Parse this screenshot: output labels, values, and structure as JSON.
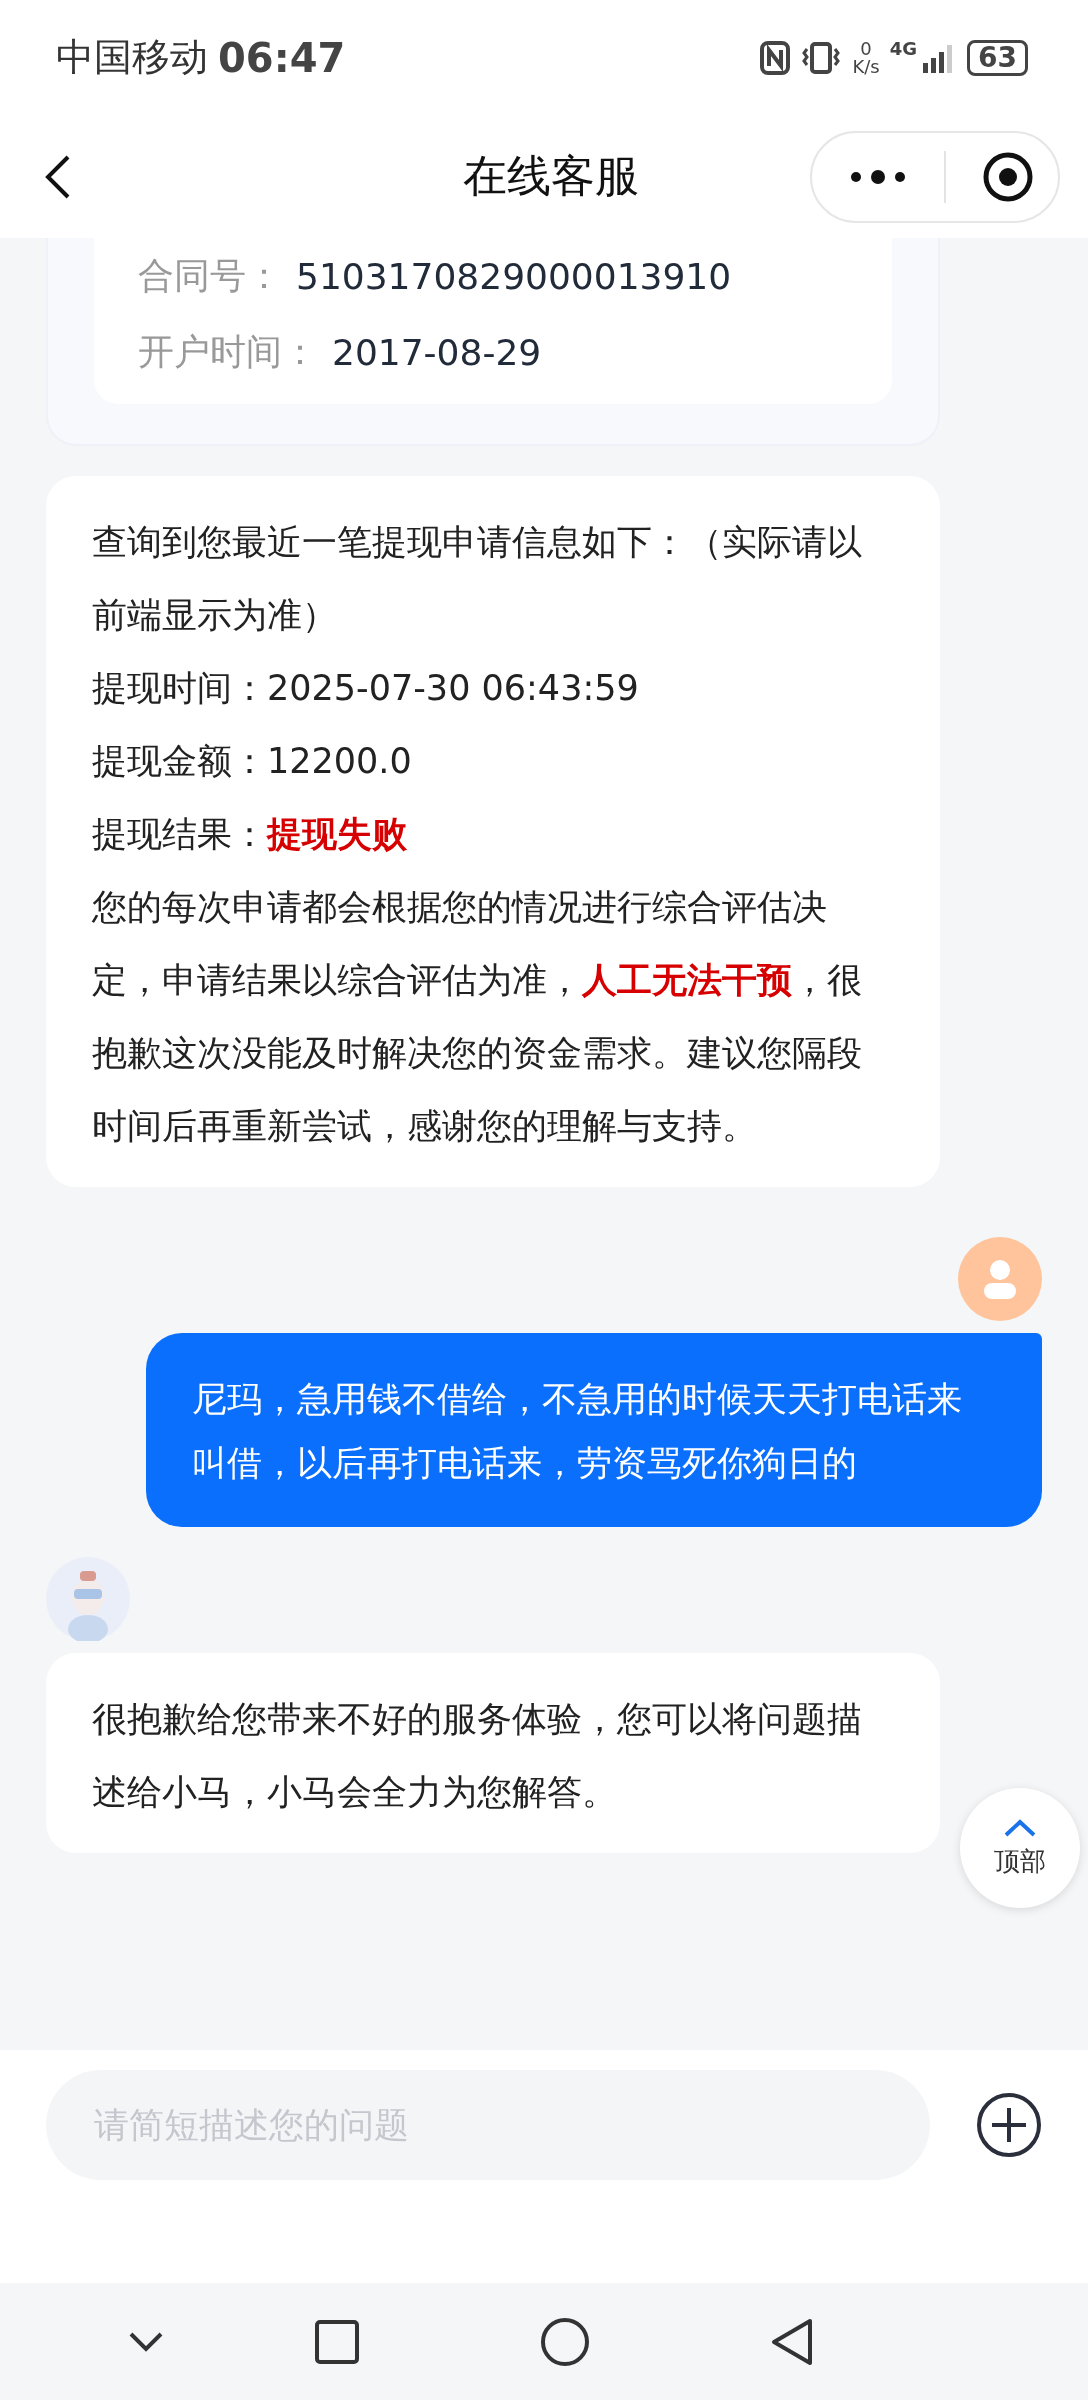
{
  "status_bar": {
    "carrier": "中国移动",
    "time": "06:47",
    "net_speed": "0",
    "net_unit": "K/s",
    "network": "4G",
    "battery": "63"
  },
  "header": {
    "title": "在线客服"
  },
  "messages": [
    {
      "kind": "card",
      "rows": [
        {
          "label": "合同号：",
          "value": "5103170829000013910"
        },
        {
          "label": "开户时间：",
          "value": "2017-08-29"
        }
      ]
    },
    {
      "kind": "bot",
      "avatar": false,
      "lines": [
        "查询到您最近一笔提现申请信息如下：（实际请以前端显示为准）",
        "提现时间：2025-07-30 06:43:59",
        "提现金额：12200.0",
        "提现结果：**提现失败**",
        "您的每次申请都会根据您的情况进行综合评估决定，申请结果以综合评估为准，**人工无法干预**，很抱歉这次没能及时解决您的资金需求。建议您隔段时间后再重新尝试，感谢您的理解与支持。"
      ]
    },
    {
      "kind": "user",
      "avatar": true,
      "lines": [
        "尼玛，急用钱不借给，不急用的时候天天打电话来叫借，以后再打电话来，劳资骂死你狗日的"
      ]
    },
    {
      "kind": "bot",
      "avatar": true,
      "lines": [
        "很抱歉给您带来不好的服务体验，您可以将问题描述给小马，小马会全力为您解答。"
      ]
    }
  ],
  "top_button": {
    "label": "顶部"
  },
  "input": {
    "placeholder": "请简短描述您的问题"
  }
}
